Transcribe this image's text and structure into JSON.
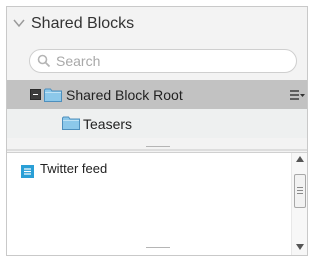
{
  "panel": {
    "title": "Shared Blocks"
  },
  "search": {
    "placeholder": "Search",
    "value": ""
  },
  "tree": {
    "root": {
      "label": "Shared Block Root",
      "icon": "folder-icon",
      "expanded": true
    },
    "children": [
      {
        "label": "Teasers",
        "icon": "folder-icon"
      }
    ]
  },
  "blocks": [
    {
      "label": "Twitter feed",
      "icon": "block-icon"
    }
  ],
  "colors": {
    "folder": "#8cc8ea",
    "block_icon": "#2a9fd6",
    "selected_row": "#c2c2c2"
  }
}
